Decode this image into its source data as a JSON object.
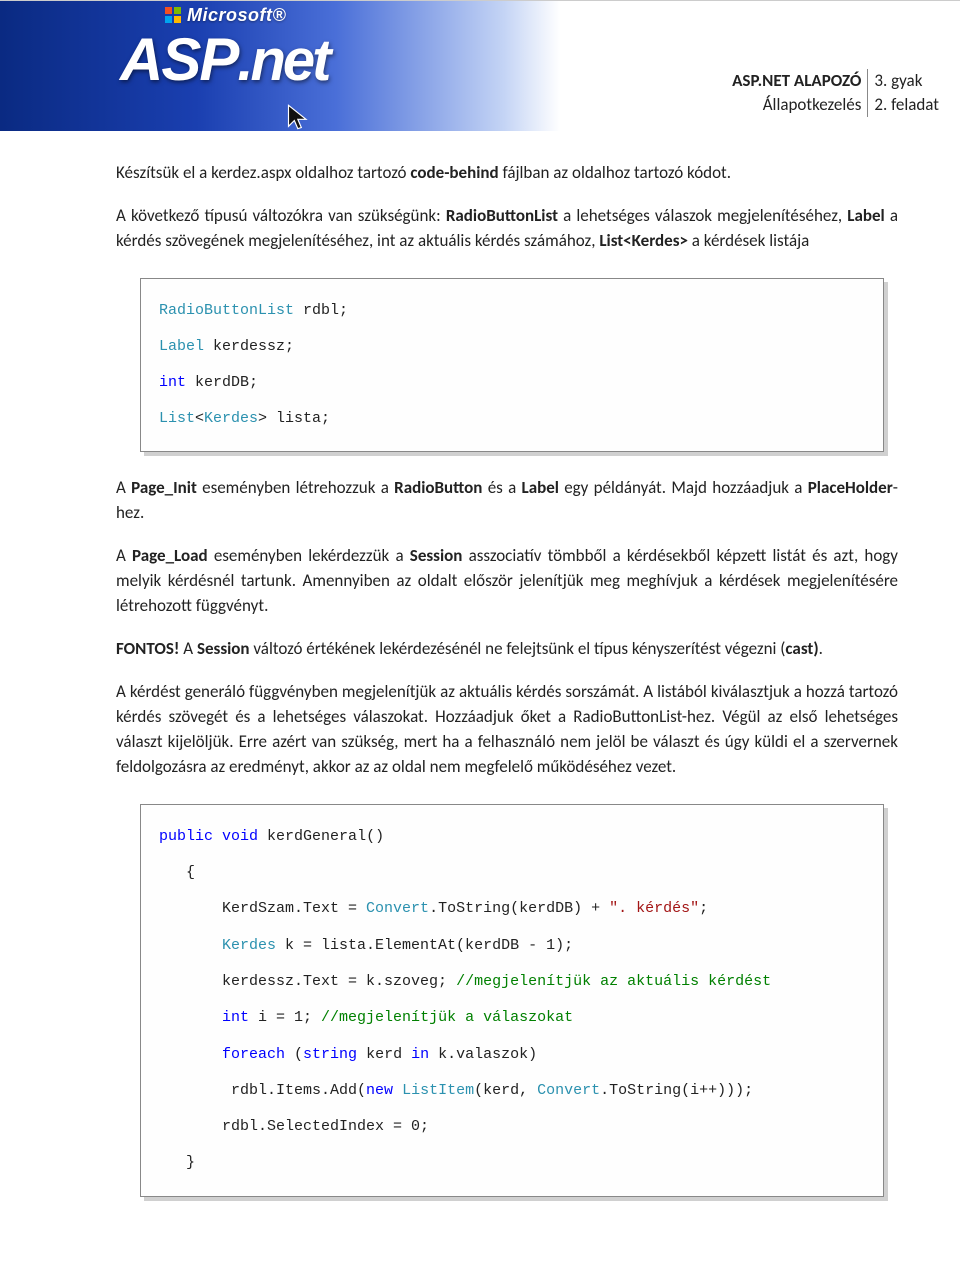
{
  "header": {
    "brand_ms": "Microsoft",
    "brand_asp": "ASP",
    "brand_net": ".net",
    "title1": "ASP.NET ALAPOZÓ",
    "title2": "Állapotkezelés",
    "right1": "3. gyak",
    "right2": "2. feladat"
  },
  "body": {
    "p1_a": "Készítsük el a kerdez.aspx oldalhoz tartozó ",
    "p1_b": "code-behind",
    "p1_c": " fájlban az oldalhoz tartozó kódot.",
    "p2_a": "A következő típusú változókra van szükségünk: ",
    "p2_b": "RadioButtonList",
    "p2_c": " a lehetséges válaszok megjelenítéséhez, ",
    "p2_d": "Label",
    "p2_e": " a kérdés szövegének megjelenítéséhez, int az aktuális kérdés számához, ",
    "p2_f": "List<Kerdes>",
    "p2_g": " a kérdések listája",
    "p3_a": "A ",
    "p3_b": "Page_Init",
    "p3_c": " eseményben létrehozzuk a ",
    "p3_d": "RadioButton",
    "p3_e": " és a ",
    "p3_f": "Label",
    "p3_g": " egy példányát. Majd hozzáadjuk a ",
    "p3_h": "PlaceHolder",
    "p3_i": "-hez.",
    "p4_a": "A ",
    "p4_b": "Page_Load",
    "p4_c": " eseményben lekérdezzük a ",
    "p4_d": "Session",
    "p4_e": " asszociatív tömbből a kérdésekből képzett listát és azt, hogy melyik kérdésnél tartunk. Amennyiben az oldalt először jelenítjük meg meghívjuk a kérdések megjelenítésére létrehozott függvényt.",
    "p5_a": "FONTOS!",
    "p5_b": " A ",
    "p5_c": "Session",
    "p5_d": " változó értékének lekérdezésénél ne felejtsünk el típus kényszerítést végezni (",
    "p5_e": "cast)",
    "p5_f": ".",
    "p6": "A kérdést generáló függvényben megjelenítjük az aktuális kérdés sorszámát. A listából kiválasztjuk a hozzá tartozó kérdés szövegét és a lehetséges válaszokat. Hozzáadjuk őket a RadioButtonList-hez. Végül az első lehetséges választ kijelöljük. Erre azért van szükség, mert ha a felhasználó nem jelöl be választ és úgy küldi el a szervernek feldolgozásra az eredményt, akkor az az oldal nem megfelelő működéséhez vezet."
  },
  "code1": {
    "l1_a": "RadioButtonList",
    "l1_b": " rdbl;",
    "l2_a": "Label",
    "l2_b": " kerdessz;",
    "l3_a": "int",
    "l3_b": " kerdDB;",
    "l4_a": "List",
    "l4_b": "<",
    "l4_c": "Kerdes",
    "l4_d": "> lista;"
  },
  "code2": {
    "l1_a": "public",
    "l1_b": " ",
    "l1_c": "void",
    "l1_d": " kerdGeneral()",
    "l2": "   {",
    "l3_a": "       KerdSzam.Text = ",
    "l3_b": "Convert",
    "l3_c": ".ToString(kerdDB) + ",
    "l3_d": "\". kérdés\"",
    "l3_e": ";",
    "l4_a": "       ",
    "l4_b": "Kerdes",
    "l4_c": " k = lista.ElementAt(kerdDB - 1);",
    "l5_a": "       kerdessz.Text = k.szoveg; ",
    "l5_b": "//megjelenítjük az aktuális kérdést",
    "l6_a": "       ",
    "l6_b": "int",
    "l6_c": " i = 1; ",
    "l6_d": "//megjelenítjük a válaszokat",
    "l7_a": "       ",
    "l7_b": "foreach",
    "l7_c": " (",
    "l7_d": "string",
    "l7_e": " kerd ",
    "l7_f": "in",
    "l7_g": " k.valaszok)",
    "l8_a": "        rdbl.Items.Add(",
    "l8_b": "new",
    "l8_c": " ",
    "l8_d": "ListItem",
    "l8_e": "(kerd, ",
    "l8_f": "Convert",
    "l8_g": ".ToString(i++)));",
    "l9": "       rdbl.SelectedIndex = 0;",
    "l10": "   }"
  }
}
